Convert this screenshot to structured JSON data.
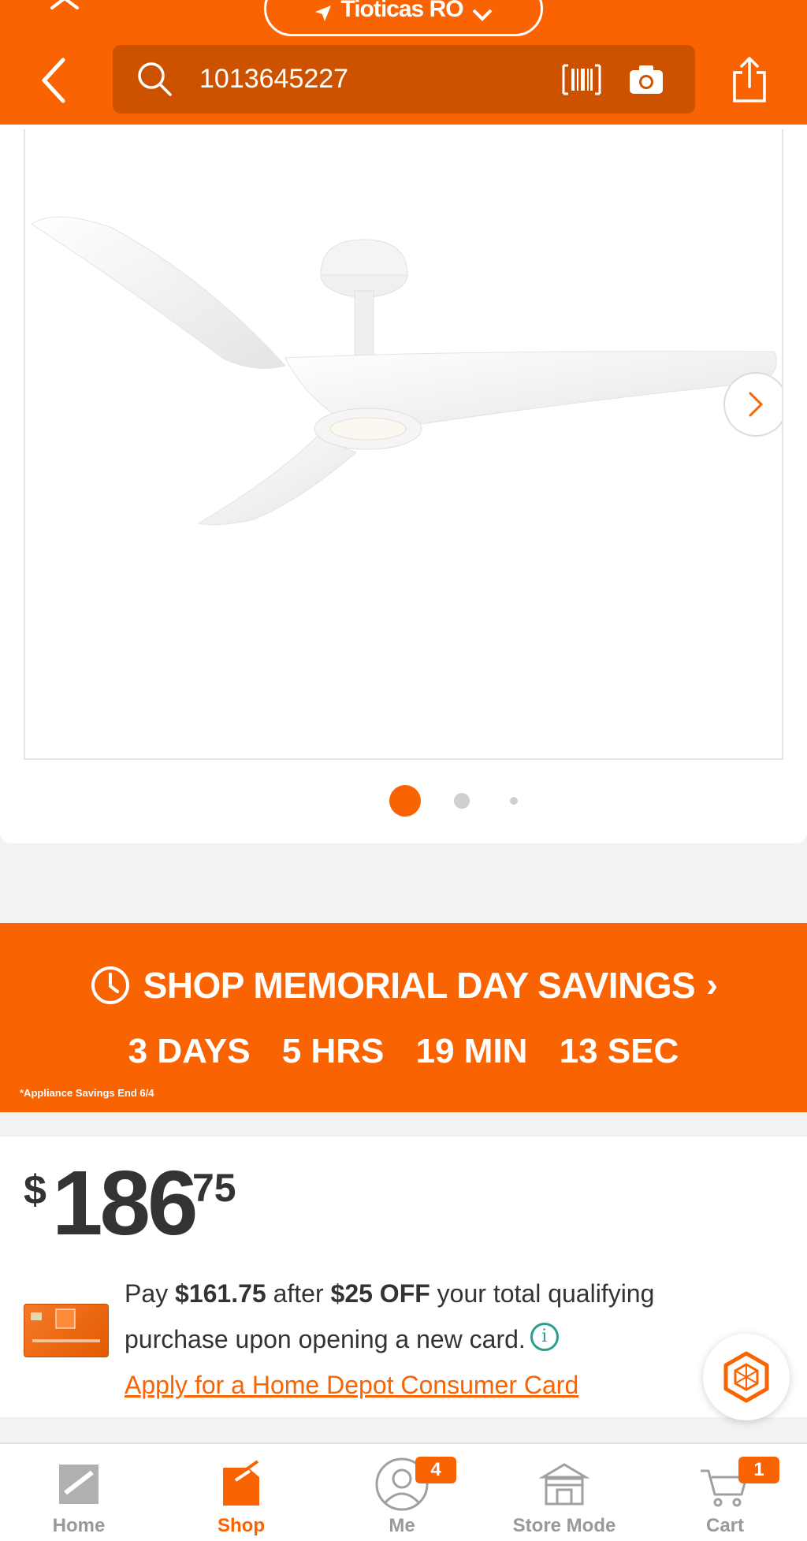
{
  "header": {
    "location_text": "Tioticas RO",
    "search_value": "1013645227"
  },
  "gallery": {
    "active_index": 0,
    "total_dots": 3
  },
  "promo": {
    "title": "SHOP MEMORIAL DAY SAVINGS",
    "chevron": "›",
    "countdown": [
      "3 DAYS",
      "5 HRS",
      "19 MIN",
      "13 SEC"
    ],
    "note": "*Appliance Savings End 6/4"
  },
  "price": {
    "currency": "$",
    "dollars": "186",
    "cents": "75"
  },
  "offer": {
    "pay": "Pay ",
    "amount": "$161.75",
    "after": " after ",
    "discount": "$25 OFF",
    "rest": " your total qualifying purchase upon opening a new card.",
    "info": "i",
    "apply_link": "Apply for a Home Depot Consumer Card"
  },
  "bottom_nav": {
    "items": [
      {
        "label": "Home",
        "icon": "home-depot-logo-icon"
      },
      {
        "label": "Shop",
        "icon": "shop-tag-icon"
      },
      {
        "label": "Me",
        "icon": "person-icon",
        "badge": "4"
      },
      {
        "label": "Store Mode",
        "icon": "store-icon"
      },
      {
        "label": "Cart",
        "icon": "cart-icon",
        "badge": "1"
      }
    ],
    "active": "Shop"
  },
  "colors": {
    "brand_orange": "#f96302",
    "search_bg": "#cc5200",
    "info_teal": "#2a9d8f"
  }
}
